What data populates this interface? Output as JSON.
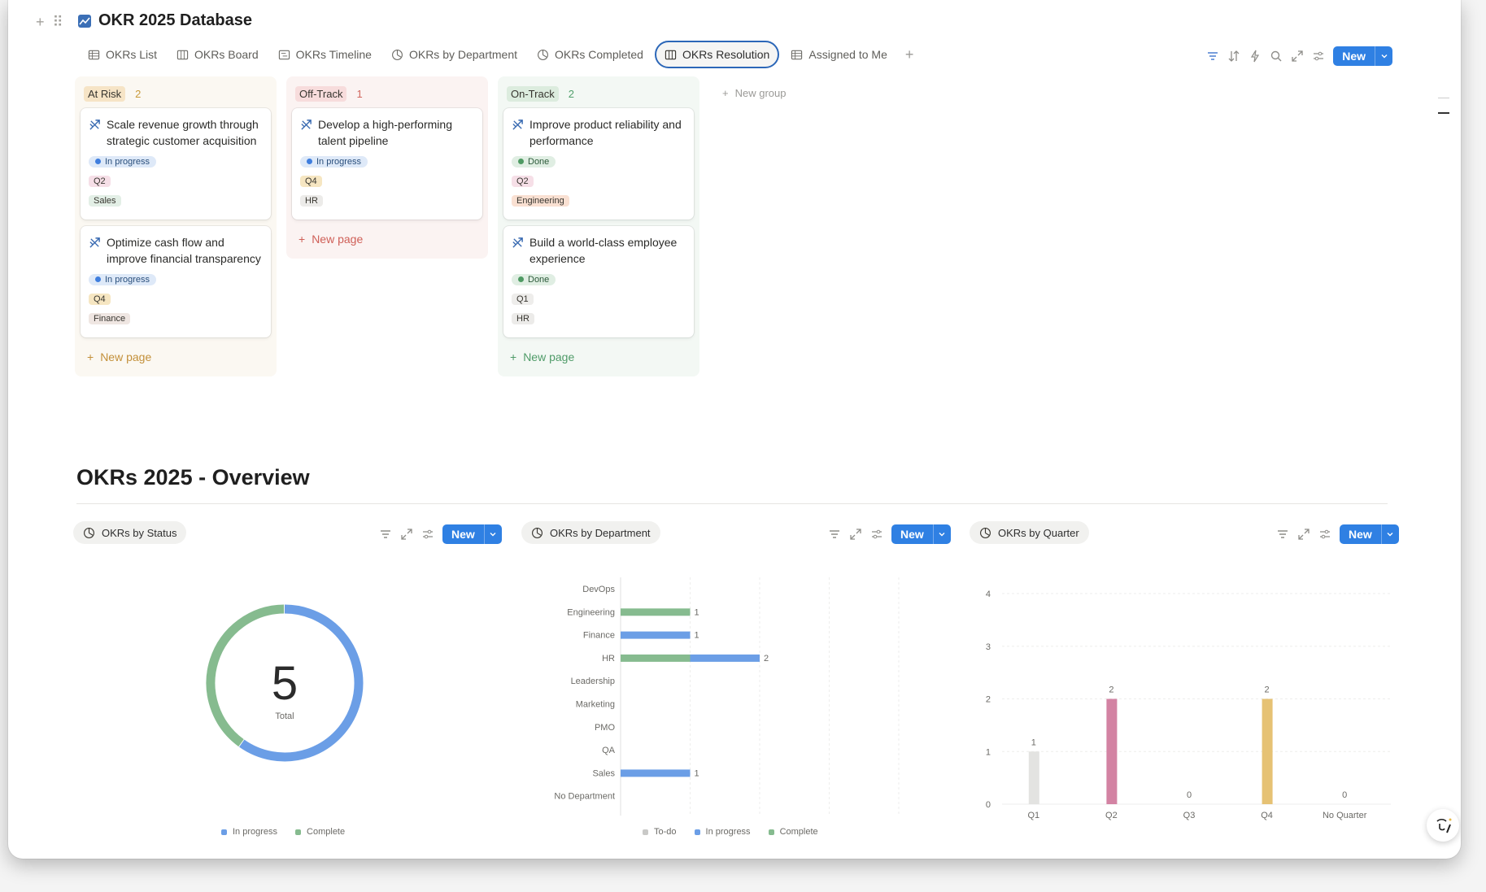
{
  "database": {
    "title": "OKR 2025 Database"
  },
  "tabs": [
    {
      "label": "OKRs List",
      "icon": "table-icon"
    },
    {
      "label": "OKRs Board",
      "icon": "board-icon"
    },
    {
      "label": "OKRs Timeline",
      "icon": "timeline-icon"
    },
    {
      "label": "OKRs by Department",
      "icon": "chart-icon"
    },
    {
      "label": "OKRs Completed",
      "icon": "chart-icon"
    },
    {
      "label": "OKRs Resolution",
      "icon": "board-icon",
      "active": true
    },
    {
      "label": "Assigned to Me",
      "icon": "table-icon"
    }
  ],
  "toolbar": {
    "new_label": "New"
  },
  "board": {
    "groups": [
      {
        "name": "At Risk",
        "count": "2",
        "new_page": "New page",
        "cards": [
          {
            "title": "Scale revenue growth through strategic customer acquisition",
            "status": "In progress",
            "quarter": "Q2",
            "department": "Sales"
          },
          {
            "title": "Optimize cash flow and improve financial transparency",
            "status": "In progress",
            "quarter": "Q4",
            "department": "Finance"
          }
        ]
      },
      {
        "name": "Off-Track",
        "count": "1",
        "new_page": "New page",
        "cards": [
          {
            "title": "Develop a high-performing talent pipeline",
            "status": "In progress",
            "quarter": "Q4",
            "department": "HR"
          }
        ]
      },
      {
        "name": "On-Track",
        "count": "2",
        "new_page": "New page",
        "cards": [
          {
            "title": "Improve product reliability and performance",
            "status": "Done",
            "quarter": "Q2",
            "department": "Engineering"
          },
          {
            "title": "Build a world-class employee experience",
            "status": "Done",
            "quarter": "Q1",
            "department": "HR"
          }
        ]
      }
    ],
    "new_group": "New group"
  },
  "overview": {
    "title": "OKRs 2025 - Overview"
  },
  "panels": [
    {
      "title": "OKRs by Status",
      "new_label": "New"
    },
    {
      "title": "OKRs by Department",
      "new_label": "New"
    },
    {
      "title": "OKRs by Quarter",
      "new_label": "New"
    }
  ],
  "colors": {
    "in_progress": "#6b9ee6",
    "complete": "#86bb8f",
    "todo": "#c9c9c7",
    "q2": "#d383a3",
    "q4": "#e6c274",
    "q1": "#e3e3e1"
  },
  "chart_data": [
    {
      "type": "pie",
      "title": "OKRs by Status",
      "center_value": "5",
      "center_label": "Total",
      "categories": [
        "In progress",
        "Complete"
      ],
      "values": [
        3,
        2
      ],
      "legend": [
        "In progress",
        "Complete"
      ]
    },
    {
      "type": "bar",
      "title": "OKRs by Department",
      "orientation": "horizontal",
      "stacked": true,
      "categories": [
        "DevOps",
        "Engineering",
        "Finance",
        "HR",
        "Leadership",
        "Marketing",
        "PMO",
        "QA",
        "Sales",
        "No Department"
      ],
      "series": [
        {
          "name": "To-do",
          "values": [
            0,
            0,
            0,
            0,
            0,
            0,
            0,
            0,
            0,
            0
          ]
        },
        {
          "name": "In progress",
          "values": [
            0,
            0,
            1,
            1,
            0,
            0,
            0,
            0,
            1,
            0
          ]
        },
        {
          "name": "Complete",
          "values": [
            0,
            1,
            0,
            1,
            0,
            0,
            0,
            0,
            0,
            0
          ]
        }
      ],
      "totals": [
        "",
        "1",
        "1",
        "2",
        "",
        "",
        "",
        "",
        "1",
        ""
      ],
      "xlim": [
        0,
        4
      ],
      "xticks": [
        "0",
        "1",
        "2",
        "3",
        "4"
      ],
      "grid": true
    },
    {
      "type": "bar",
      "title": "OKRs by Quarter",
      "categories": [
        "Q1",
        "Q2",
        "Q3",
        "Q4",
        "No Quarter"
      ],
      "values": [
        1,
        2,
        0,
        2,
        0
      ],
      "value_labels": [
        "1",
        "2",
        "0",
        "2",
        "0"
      ],
      "ylim": [
        0,
        4
      ],
      "yticks": [
        "0",
        "1",
        "2",
        "3",
        "4"
      ],
      "grid": true
    }
  ]
}
